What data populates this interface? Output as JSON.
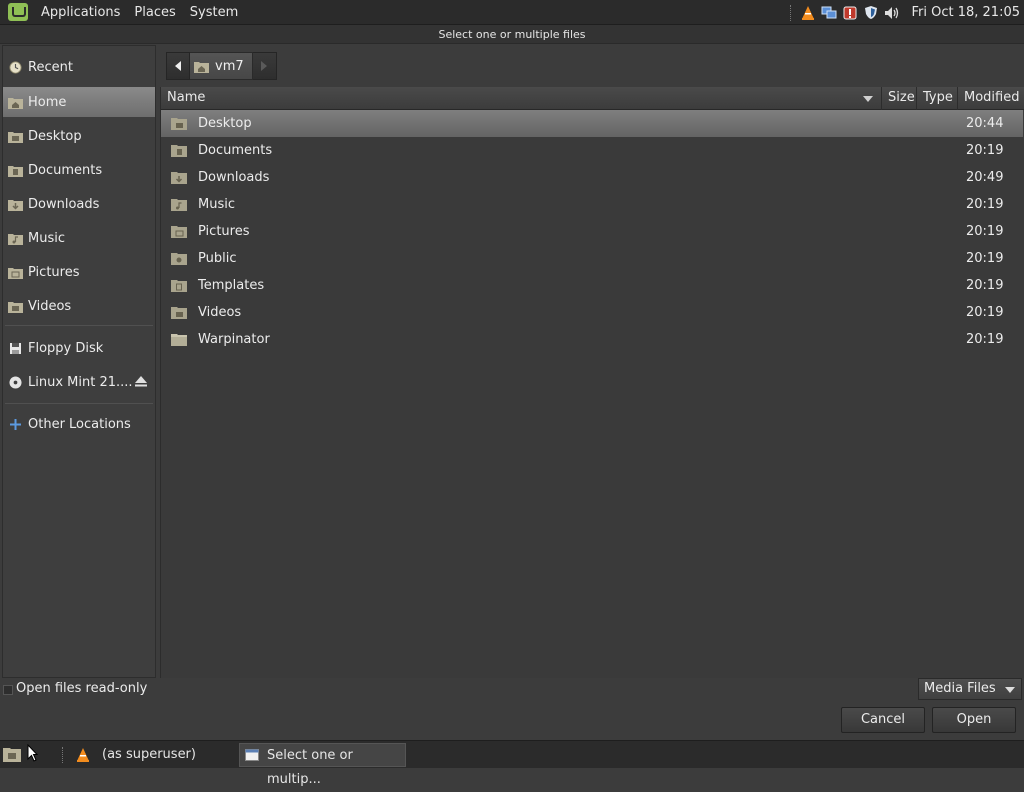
{
  "top_panel": {
    "menus": [
      "Applications",
      "Places",
      "System"
    ],
    "clock": "Fri Oct 18, 21:05",
    "tray_icons": [
      "vlc-icon",
      "network-icon",
      "update-alert-icon",
      "shield-icon",
      "volume-icon"
    ]
  },
  "dialog": {
    "title": "Select one or multiple files"
  },
  "sidebar": {
    "items": [
      {
        "label": "Recent",
        "icon": "recent-icon"
      },
      {
        "label": "Home",
        "icon": "home-folder-icon",
        "selected": true
      },
      {
        "label": "Desktop",
        "icon": "folder-icon"
      },
      {
        "label": "Documents",
        "icon": "folder-icon"
      },
      {
        "label": "Downloads",
        "icon": "folder-icon"
      },
      {
        "label": "Music",
        "icon": "folder-icon"
      },
      {
        "label": "Pictures",
        "icon": "folder-icon"
      },
      {
        "label": "Videos",
        "icon": "folder-icon"
      },
      {
        "label": "Floppy Disk",
        "icon": "floppy-icon"
      },
      {
        "label": "Linux Mint 21....",
        "icon": "disc-icon"
      },
      {
        "label": "Other Locations",
        "icon": "plus-icon"
      }
    ]
  },
  "pathbar": {
    "current": "vm7"
  },
  "columns": {
    "name": "Name",
    "size": "Size",
    "type": "Type",
    "modified": "Modified"
  },
  "files": [
    {
      "name": "Desktop",
      "modified": "20:44",
      "selected": true
    },
    {
      "name": "Documents",
      "modified": "20:19"
    },
    {
      "name": "Downloads",
      "modified": "20:49"
    },
    {
      "name": "Music",
      "modified": "20:19"
    },
    {
      "name": "Pictures",
      "modified": "20:19"
    },
    {
      "name": "Public",
      "modified": "20:19"
    },
    {
      "name": "Templates",
      "modified": "20:19"
    },
    {
      "name": "Videos",
      "modified": "20:19"
    },
    {
      "name": "Warpinator",
      "modified": "20:19"
    }
  ],
  "bottom": {
    "read_only_label": "Open files read-only",
    "filter": "Media Files",
    "cancel": "Cancel",
    "open": "Open"
  },
  "taskbar": {
    "items": [
      "(as superuser)",
      "Select one or multip..."
    ]
  },
  "colors": {
    "panel": "#2b2b2b",
    "background": "#3c3c3c",
    "selection": "#7a7a7a",
    "mint_green": "#8fbf55"
  }
}
